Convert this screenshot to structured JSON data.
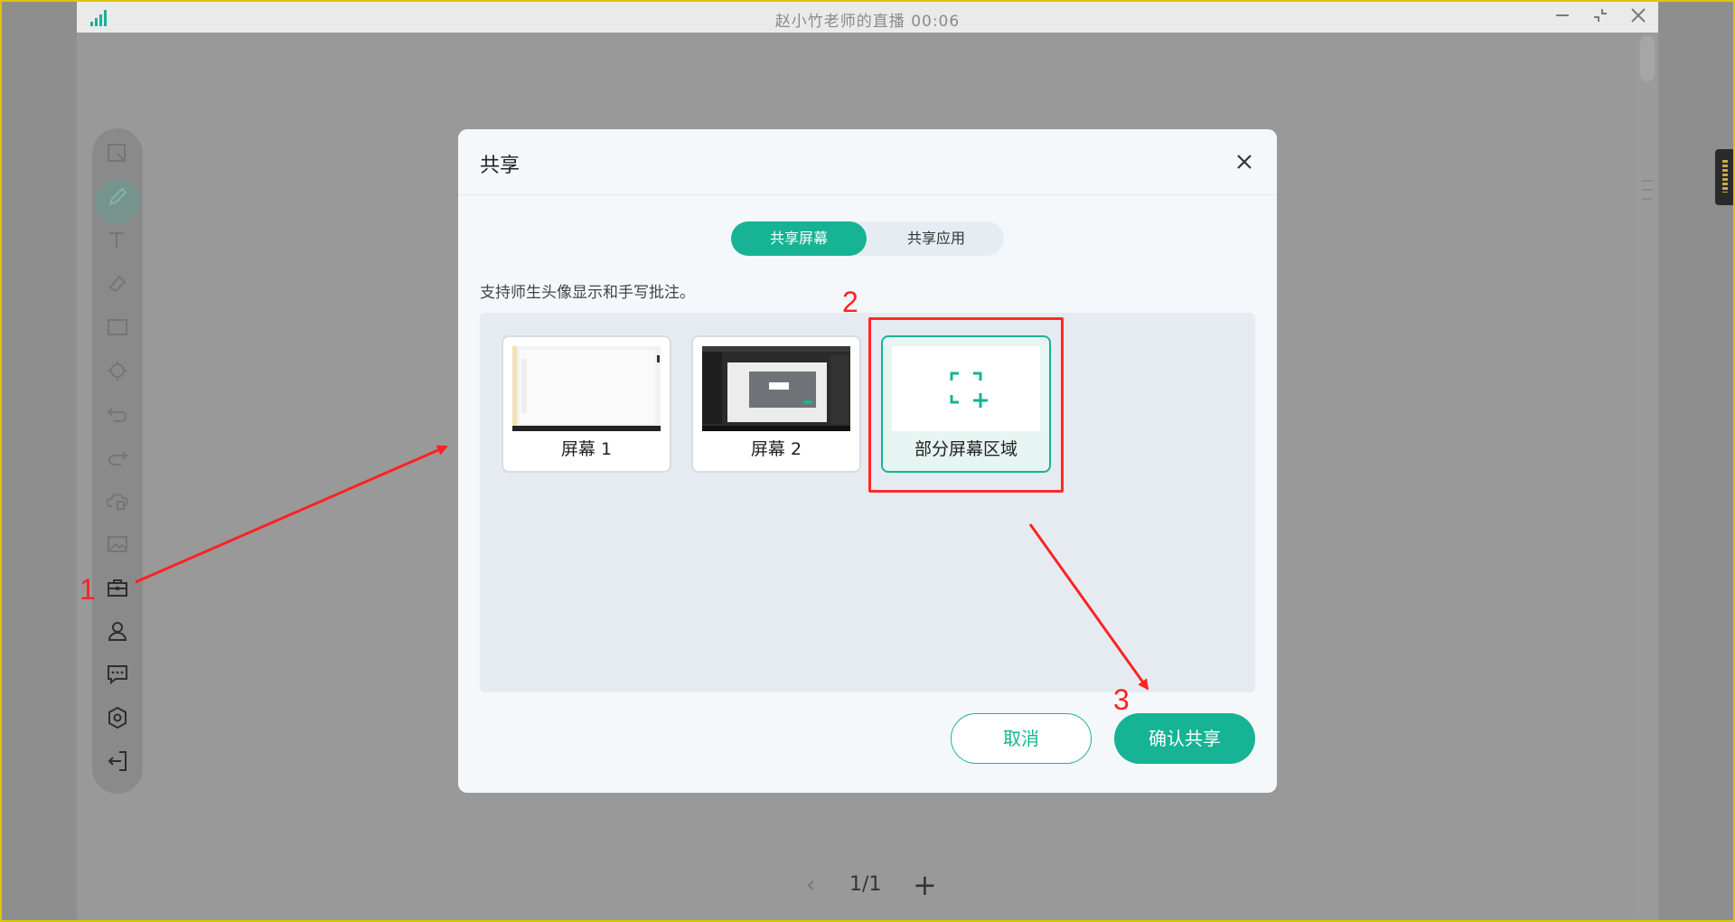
{
  "window": {
    "title": "赵小竹老师的直播  00:06",
    "controls": [
      "minimize-icon",
      "restore-icon",
      "close-icon"
    ]
  },
  "toolbar": {
    "tools": [
      "select-icon",
      "pen-icon",
      "text-icon",
      "eraser-icon",
      "rectangle-icon",
      "laser-pointer-icon",
      "undo-icon",
      "redo-icon",
      "cloud-file-icon",
      "image-icon",
      "toolbox-icon",
      "user-icon",
      "chat-icon",
      "settings-icon",
      "exit-icon"
    ],
    "active_tool": "pen-icon"
  },
  "pager": {
    "page": "1/1"
  },
  "dialog": {
    "title": "共享",
    "tabs": [
      {
        "label": "共享屏幕",
        "active": true
      },
      {
        "label": "共享应用",
        "active": false
      }
    ],
    "hint": "支持师生头像显示和手写批注。",
    "options": [
      {
        "label": "屏幕 1",
        "selected": false
      },
      {
        "label": "屏幕 2",
        "selected": false
      },
      {
        "label": "部分屏幕区域",
        "selected": true
      }
    ],
    "cancel_label": "取消",
    "confirm_label": "确认共享"
  },
  "annotations": {
    "step1": "1",
    "step2": "2",
    "step3": "3"
  },
  "colors": {
    "accent": "#16b394",
    "annotation": "#ff2222"
  }
}
